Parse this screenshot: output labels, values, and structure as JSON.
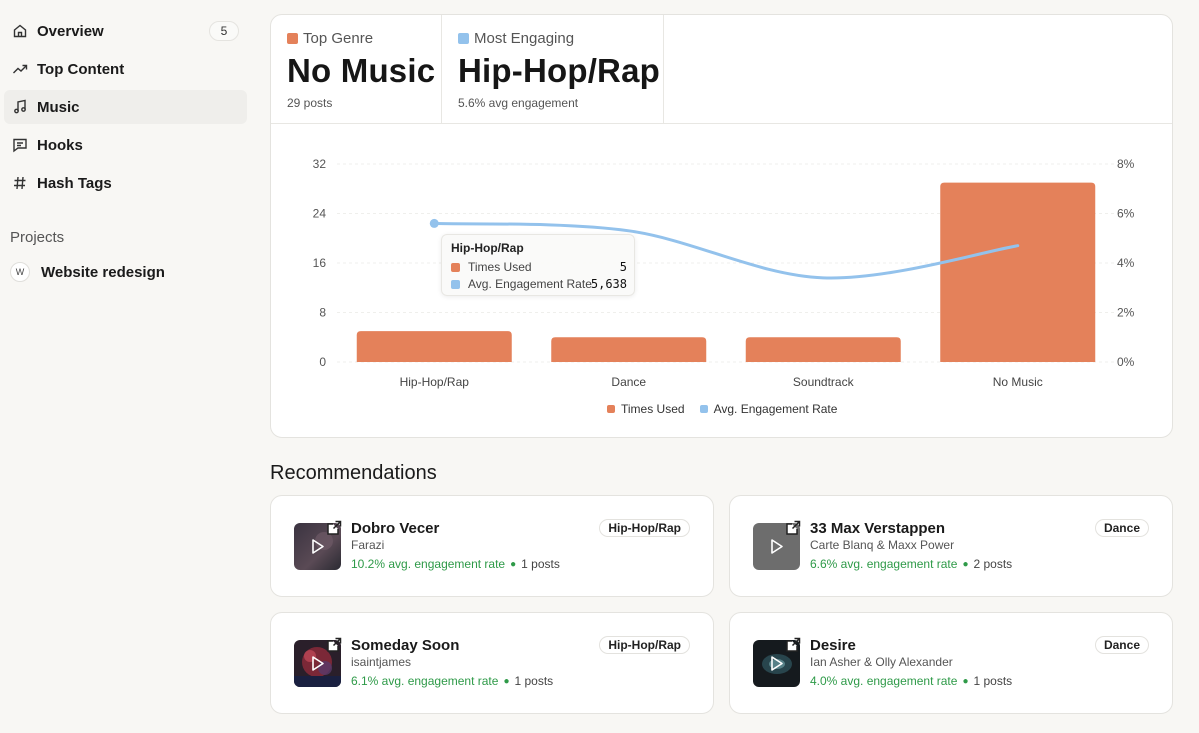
{
  "sidebar": {
    "items": [
      {
        "label": "Overview",
        "icon": "home-icon",
        "badge": "5"
      },
      {
        "label": "Top Content",
        "icon": "trending-icon"
      },
      {
        "label": "Music",
        "icon": "music-note-icon",
        "active": true
      },
      {
        "label": "Hooks",
        "icon": "message-square-icon"
      },
      {
        "label": "Hash Tags",
        "icon": "hash-icon"
      }
    ],
    "projects_title": "Projects",
    "projects": [
      {
        "avatar": "W",
        "label": "Website redesign"
      }
    ]
  },
  "stats": {
    "top_genre": {
      "label": "Top Genre",
      "value": "No Music",
      "sub": "29 posts",
      "color": "#e4815a"
    },
    "most_engaging": {
      "label": "Most Engaging",
      "value": "Hip-Hop/Rap",
      "sub": "5.6% avg engagement",
      "color": "#93c2ec"
    }
  },
  "chart_data": {
    "type": "bar",
    "categories": [
      "Hip-Hop/Rap",
      "Dance",
      "Soundtrack",
      "No Music"
    ],
    "series": [
      {
        "name": "Times Used",
        "type": "bar",
        "axis": "left",
        "color": "#e4815a",
        "values": [
          5,
          4,
          4,
          29
        ]
      },
      {
        "name": "Avg. Engagement Rate",
        "type": "line",
        "axis": "right",
        "color": "#93c2ec",
        "values": [
          5.6,
          5.3,
          3.4,
          4.7
        ]
      }
    ],
    "y_left": {
      "ticks": [
        "32",
        "24",
        "16",
        "8",
        "0"
      ],
      "ylim": [
        0,
        32
      ]
    },
    "y_right": {
      "ticks": [
        "8%",
        "6%",
        "4%",
        "2%",
        "0%"
      ],
      "ylim": [
        0,
        8
      ]
    },
    "grid": true,
    "legend": "bottom-center",
    "tooltip": {
      "title": "Hip-Hop/Rap",
      "rows": [
        {
          "label": "Times Used",
          "value": "5"
        },
        {
          "label": "Avg. Engagement Rate",
          "value": "5,638"
        }
      ]
    }
  },
  "recommendations": {
    "title": "Recommendations",
    "items": [
      {
        "name": "Dobro Vecer",
        "artist": "Farazi",
        "rate": "10.2% avg. engagement rate",
        "posts": "1 posts",
        "genre": "Hip-Hop/Rap"
      },
      {
        "name": "33 Max Verstappen",
        "artist": "Carte Blanq & Maxx Power",
        "rate": "6.6% avg. engagement rate",
        "posts": "2 posts",
        "genre": "Dance"
      },
      {
        "name": "Someday Soon",
        "artist": "isaintjames",
        "rate": "6.1% avg. engagement rate",
        "posts": "1 posts",
        "genre": "Hip-Hop/Rap"
      },
      {
        "name": "Desire",
        "artist": "Ian Asher & Olly Alexander",
        "rate": "4.0% avg. engagement rate",
        "posts": "1 posts",
        "genre": "Dance"
      }
    ]
  }
}
